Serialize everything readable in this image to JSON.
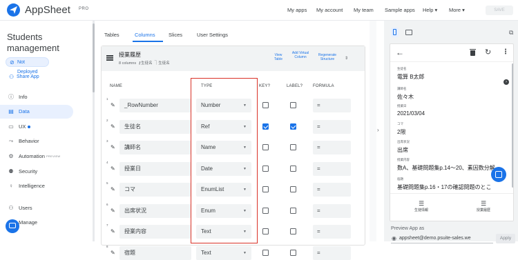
{
  "topbar": {
    "brand": "AppSheet",
    "brand_badge": "PRO",
    "nav": [
      "My apps",
      "My account",
      "My team",
      "Sample apps",
      "Help ▾",
      "More ▾"
    ],
    "save_label": "SAVE"
  },
  "leftnav": {
    "app_title": "Students management",
    "deploy_status": "Not Deployed",
    "share_label": "Share App",
    "items": [
      {
        "label": "Info",
        "icon": "info-icon"
      },
      {
        "label": "Data",
        "icon": "database-icon"
      },
      {
        "label": "UX",
        "icon": "ux-icon"
      },
      {
        "label": "Behavior",
        "icon": "behavior-icon"
      },
      {
        "label": "Automation",
        "icon": "automation-icon",
        "badge": "PREVIEW"
      },
      {
        "label": "Security",
        "icon": "security-icon"
      },
      {
        "label": "Intelligence",
        "icon": "intelligence-icon"
      },
      {
        "label": "Users",
        "icon": "users-icon"
      },
      {
        "label": "Manage",
        "icon": "manage-icon"
      }
    ]
  },
  "main": {
    "tabs": [
      "Tables",
      "Columns",
      "Slices",
      "User Settings"
    ],
    "active_tab": "Columns",
    "table": {
      "name": "授業履歴",
      "meta_columns": "8 columns",
      "meta_key": "生徒名",
      "meta_label": "生徒名",
      "view_table": "View Table",
      "add_virtual": "Add Virtual Column",
      "regenerate": "Regenerate Structure"
    },
    "headers": {
      "name": "NAME",
      "type": "TYPE",
      "key": "KEY?",
      "label": "LABEL?",
      "formula": "FORMULA"
    },
    "rows": [
      {
        "num": "1",
        "name": "_RowNumber",
        "type": "Number",
        "key": false,
        "label": false,
        "formula": "="
      },
      {
        "num": "2",
        "name": "生徒名",
        "type": "Ref",
        "key": true,
        "label": true,
        "formula": "="
      },
      {
        "num": "3",
        "name": "講師名",
        "type": "Name",
        "key": false,
        "label": false,
        "formula": "="
      },
      {
        "num": "4",
        "name": "授業日",
        "type": "Date",
        "key": false,
        "label": false,
        "formula": "="
      },
      {
        "num": "5",
        "name": "コマ",
        "type": "EnumList",
        "key": false,
        "label": false,
        "formula": "="
      },
      {
        "num": "6",
        "name": "出席状況",
        "type": "Enum",
        "key": false,
        "label": false,
        "formula": "="
      },
      {
        "num": "7",
        "name": "授業内容",
        "type": "Text",
        "key": false,
        "label": false,
        "formula": "="
      },
      {
        "num": "8",
        "name": "宿題",
        "type": "Text",
        "key": false,
        "label": false,
        "formula": "="
      }
    ]
  },
  "preview": {
    "fields": [
      {
        "label": "生徒名",
        "value": "電算 B太郎"
      },
      {
        "label": "講師名",
        "value": "佐々木"
      },
      {
        "label": "授業日",
        "value": "2021/03/04"
      },
      {
        "label": "コマ",
        "value": "2限"
      },
      {
        "label": "出席状況",
        "value": "出席"
      },
      {
        "label": "授業内容",
        "value": "数A、基礎問題集p.14〜20、素因数分解"
      },
      {
        "label": "宿題",
        "value": "基礎問題集p.16・17の確認問題のとこ"
      }
    ],
    "bottom_nav": [
      "生徒情報",
      "授業履歴"
    ],
    "preview_as_label": "Preview App as",
    "preview_as_value": "appsheet@demo.psuite-sales.we",
    "apply_label": "Apply"
  },
  "colors": {
    "accent": "#1a73e8",
    "highlight": "#d93025"
  }
}
